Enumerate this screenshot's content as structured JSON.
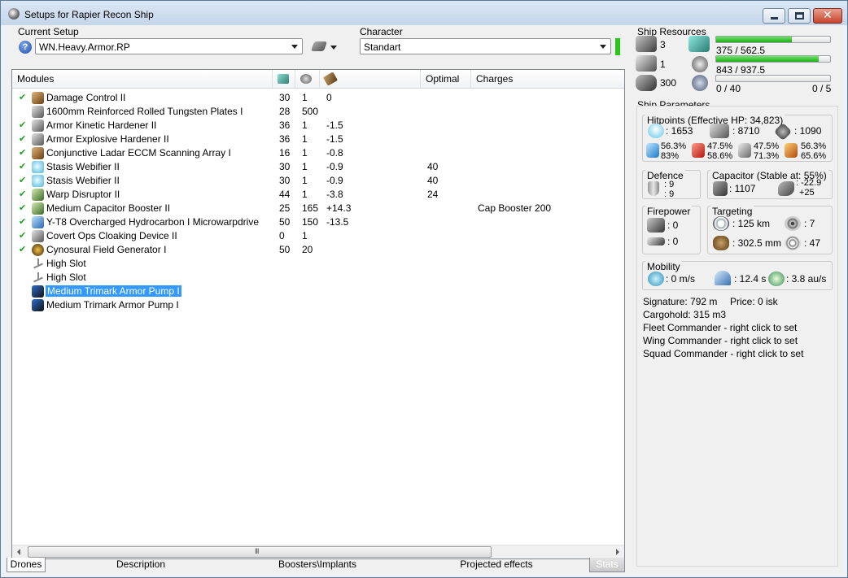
{
  "window": {
    "title": "Setups for Rapier Recon Ship"
  },
  "setup": {
    "label": "Current Setup",
    "value": "WN.Heavy.Armor.RP"
  },
  "character": {
    "label": "Character",
    "value": "Standart"
  },
  "modules": {
    "columns": {
      "modules": "Modules",
      "optimal": "Optimal",
      "charges": "Charges"
    },
    "rows": [
      {
        "check": "✔",
        "icon": "damage-control-icon",
        "name": "Damage Control II",
        "cpu": "30",
        "pg": "1",
        "cap": "0",
        "optimal": "",
        "charges": ""
      },
      {
        "check": "",
        "icon": "armor-plate-icon",
        "name": "1600mm Reinforced Rolled Tungsten Plates I",
        "cpu": "28",
        "pg": "500",
        "cap": "",
        "optimal": "",
        "charges": ""
      },
      {
        "check": "✔",
        "icon": "armor-hardener-icon",
        "name": "Armor Kinetic Hardener II",
        "cpu": "36",
        "pg": "1",
        "cap": "-1.5",
        "optimal": "",
        "charges": ""
      },
      {
        "check": "✔",
        "icon": "armor-hardener-icon",
        "name": "Armor Explosive Hardener II",
        "cpu": "36",
        "pg": "1",
        "cap": "-1.5",
        "optimal": "",
        "charges": ""
      },
      {
        "check": "✔",
        "icon": "eccm-icon",
        "name": "Conjunctive Ladar ECCM Scanning Array I",
        "cpu": "16",
        "pg": "1",
        "cap": "-0.8",
        "optimal": "",
        "charges": ""
      },
      {
        "check": "✔",
        "icon": "stasis-webifier-icon",
        "name": "Stasis Webifier II",
        "cpu": "30",
        "pg": "1",
        "cap": "-0.9",
        "optimal": "40",
        "charges": ""
      },
      {
        "check": "✔",
        "icon": "stasis-webifier-icon",
        "name": "Stasis Webifier II",
        "cpu": "30",
        "pg": "1",
        "cap": "-0.9",
        "optimal": "40",
        "charges": ""
      },
      {
        "check": "✔",
        "icon": "warp-disruptor-icon",
        "name": "Warp Disruptor II",
        "cpu": "44",
        "pg": "1",
        "cap": "-3.8",
        "optimal": "24",
        "charges": ""
      },
      {
        "check": "✔",
        "icon": "capacitor-booster-icon",
        "name": "Medium Capacitor Booster II",
        "cpu": "25",
        "pg": "165",
        "cap": "+14.3",
        "optimal": "",
        "charges": "Cap Booster 200"
      },
      {
        "check": "✔",
        "icon": "microwarpdrive-icon",
        "name": "Y-T8 Overcharged Hydrocarbon I Microwarpdrive",
        "cpu": "50",
        "pg": "150",
        "cap": "-13.5",
        "optimal": "",
        "charges": ""
      },
      {
        "check": "✔",
        "icon": "cloaking-device-icon",
        "name": "Covert Ops Cloaking Device II",
        "cpu": "0",
        "pg": "1",
        "cap": "",
        "optimal": "",
        "charges": ""
      },
      {
        "check": "✔",
        "icon": "cynosural-field-icon",
        "name": "Cynosural Field Generator I",
        "cpu": "50",
        "pg": "20",
        "cap": "",
        "optimal": "",
        "charges": ""
      },
      {
        "check": "",
        "icon": "empty-high-slot-icon",
        "name": "High Slot",
        "cpu": "",
        "pg": "",
        "cap": "",
        "optimal": "",
        "charges": ""
      },
      {
        "check": "",
        "icon": "empty-high-slot-icon",
        "name": "High Slot",
        "cpu": "",
        "pg": "",
        "cap": "",
        "optimal": "",
        "charges": ""
      },
      {
        "check": "",
        "icon": "rig-icon",
        "name": "Medium Trimark Armor Pump I",
        "cpu": "",
        "pg": "",
        "cap": "",
        "optimal": "",
        "charges": "",
        "selected": true
      },
      {
        "check": "",
        "icon": "rig-icon",
        "name": "Medium Trimark Armor Pump I",
        "cpu": "",
        "pg": "",
        "cap": "",
        "optimal": "",
        "charges": ""
      }
    ]
  },
  "tabs": {
    "drones": "Drones",
    "description": "Description",
    "boosters": "Boosters\\Implants",
    "projected": "Projected effects",
    "stats": "Stats"
  },
  "resources": {
    "title": "Ship Resources",
    "turrets": "3",
    "launchers": "1",
    "calibration": "300",
    "cpu": {
      "text": "375 / 562.5",
      "fraction": 0.667
    },
    "powergrid": {
      "text": "843 / 937.5",
      "fraction": 0.9
    },
    "drone_bay": "0 / 40",
    "drone_bandwidth": "0 / 5",
    "drone_fraction": 0.0
  },
  "params": {
    "title": "Ship Parameters",
    "hitpoints_title": "Hitpoints (Effective HP: 34,823)",
    "shield_hp": ": 1653",
    "armor_hp": ": 8710",
    "hull_hp": ": 1090",
    "em_shield": "56.3%",
    "em_armor": "83%",
    "th_shield": "47.5%",
    "th_armor": "58.6%",
    "kin_shield": "47.5%",
    "kin_armor": "71.3%",
    "exp_shield": "56.3%",
    "exp_armor": "65.6%",
    "defence_title": "Defence",
    "defence_1": ": 9",
    "defence_2": ": 9",
    "capacitor_title": "Capacitor (Stable at: 55%)",
    "capacitor_value": ": 1107",
    "capacitor_delta1": ": -22.9",
    "capacitor_delta2": "+25",
    "firepower_title": "Firepower",
    "firepower_turret": ": 0",
    "firepower_drone": ": 0",
    "targeting_title": "Targeting",
    "target_range": ": 125 km",
    "max_targets": ": 7",
    "scan_res": ": 302.5 mm",
    "sensor_strength": ": 47",
    "mobility_title": "Mobility",
    "speed": ": 0 m/s",
    "align_time": ": 12.4 s",
    "warp_speed": ": 3.8 au/s",
    "signature": "Signature: 792 m",
    "price": "Price: 0 isk",
    "cargohold": "Cargohold: 315 m3",
    "fleet_commander": "Fleet Commander - right click to set",
    "wing_commander": "Wing Commander - right click to set",
    "squad_commander": "Squad Commander - right click to set"
  }
}
